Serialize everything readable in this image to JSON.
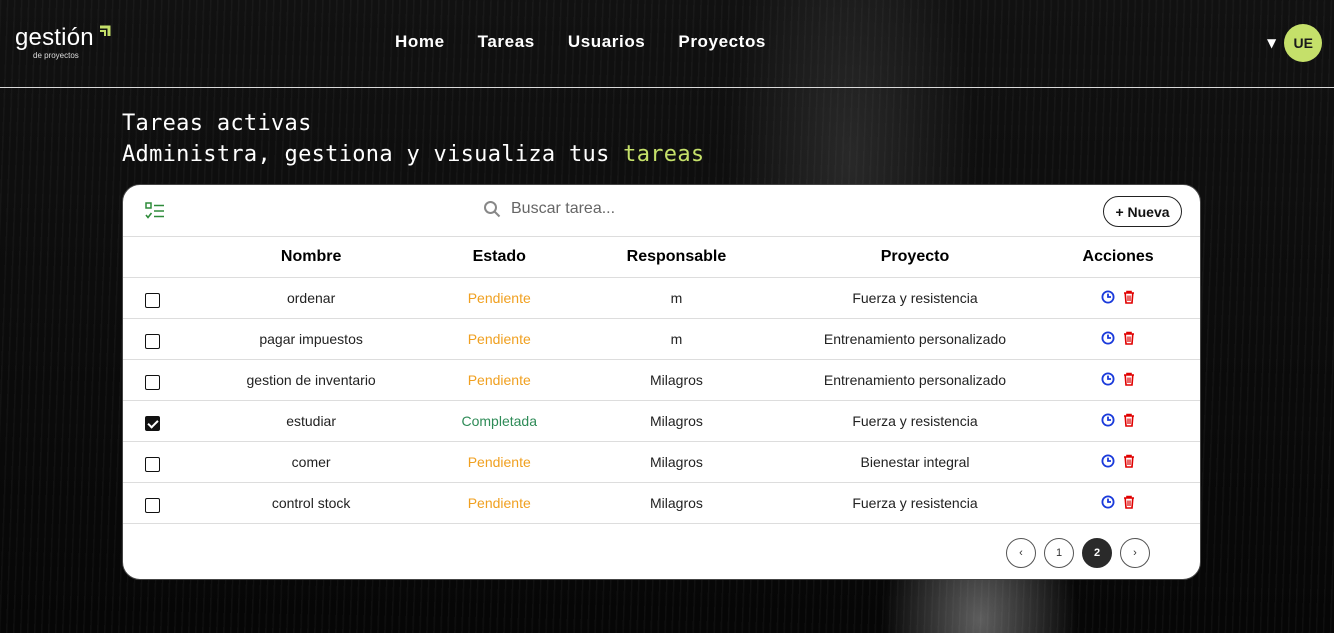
{
  "brand": {
    "name": "gestión",
    "tagline": "de proyectos"
  },
  "nav": {
    "items": [
      "Home",
      "Tareas",
      "Usuarios",
      "Proyectos"
    ]
  },
  "user": {
    "initials": "UE",
    "caret": "▼"
  },
  "page": {
    "title": "Tareas activas",
    "subtitle_prefix": "Administra, gestiona y visualiza tus",
    "subtitle_accent": "tareas"
  },
  "toolbar": {
    "search_placeholder": "Buscar tarea...",
    "new_label": "+ Nueva"
  },
  "table": {
    "headers": {
      "name": "Nombre",
      "state": "Estado",
      "responsible": "Responsable",
      "project": "Proyecto",
      "actions": "Acciones"
    },
    "rows": [
      {
        "checked": false,
        "name": "ordenar",
        "state": "Pendiente",
        "responsible": "m",
        "project": "Fuerza y resistencia"
      },
      {
        "checked": false,
        "name": "pagar impuestos",
        "state": "Pendiente",
        "responsible": "m",
        "project": "Entrenamiento personalizado"
      },
      {
        "checked": false,
        "name": "gestion de inventario",
        "state": "Pendiente",
        "responsible": "Milagros",
        "project": "Entrenamiento personalizado"
      },
      {
        "checked": true,
        "name": "estudiar",
        "state": "Completada",
        "responsible": "Milagros",
        "project": "Fuerza y resistencia"
      },
      {
        "checked": false,
        "name": "comer",
        "state": "Pendiente",
        "responsible": "Milagros",
        "project": "Bienestar integral"
      },
      {
        "checked": false,
        "name": "control stock",
        "state": "Pendiente",
        "responsible": "Milagros",
        "project": "Fuerza y resistencia"
      }
    ]
  },
  "pagination": {
    "prev": "‹",
    "pages": [
      "1",
      "2"
    ],
    "current": "2",
    "next": "›"
  },
  "colors": {
    "accent": "#c5e06a",
    "pending": "#f0a020",
    "done": "#2e8b57",
    "edit_icon": "#1a3adb",
    "delete_icon": "#e00000"
  },
  "icons": {
    "list": "checklist-icon",
    "search": "search-icon",
    "edit": "clock-edit-icon",
    "delete": "trash-icon"
  }
}
